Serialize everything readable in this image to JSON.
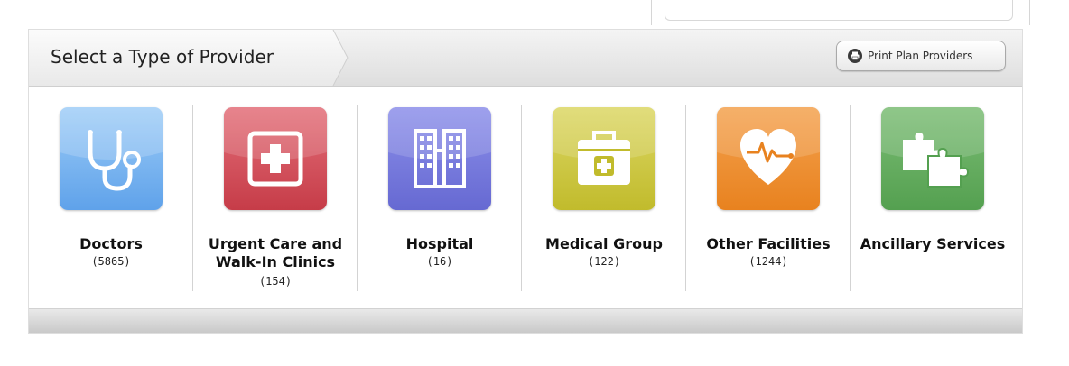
{
  "header": {
    "title": "Select a Type of Provider",
    "print_label": "Print Plan Providers"
  },
  "providers": [
    {
      "title": "Doctors",
      "count": "(5865)",
      "icon": "stethoscope-icon",
      "color": "#6aaef0"
    },
    {
      "title": "Urgent Care and Walk-In Clinics",
      "count": "(154)",
      "icon": "medical-cross-icon",
      "color": "#d34a57"
    },
    {
      "title": "Hospital",
      "count": "(16)",
      "icon": "hospital-building-icon",
      "color": "#6f73d9"
    },
    {
      "title": "Medical Group",
      "count": "(122)",
      "icon": "medical-kit-icon",
      "color": "#c9c33a"
    },
    {
      "title": "Other Facilities",
      "count": "(1244)",
      "icon": "heart-pulse-icon",
      "color": "#ee8a2e"
    },
    {
      "title": "Ancillary Services",
      "count": "",
      "icon": "puzzle-pieces-icon",
      "color": "#5fa65b"
    }
  ]
}
